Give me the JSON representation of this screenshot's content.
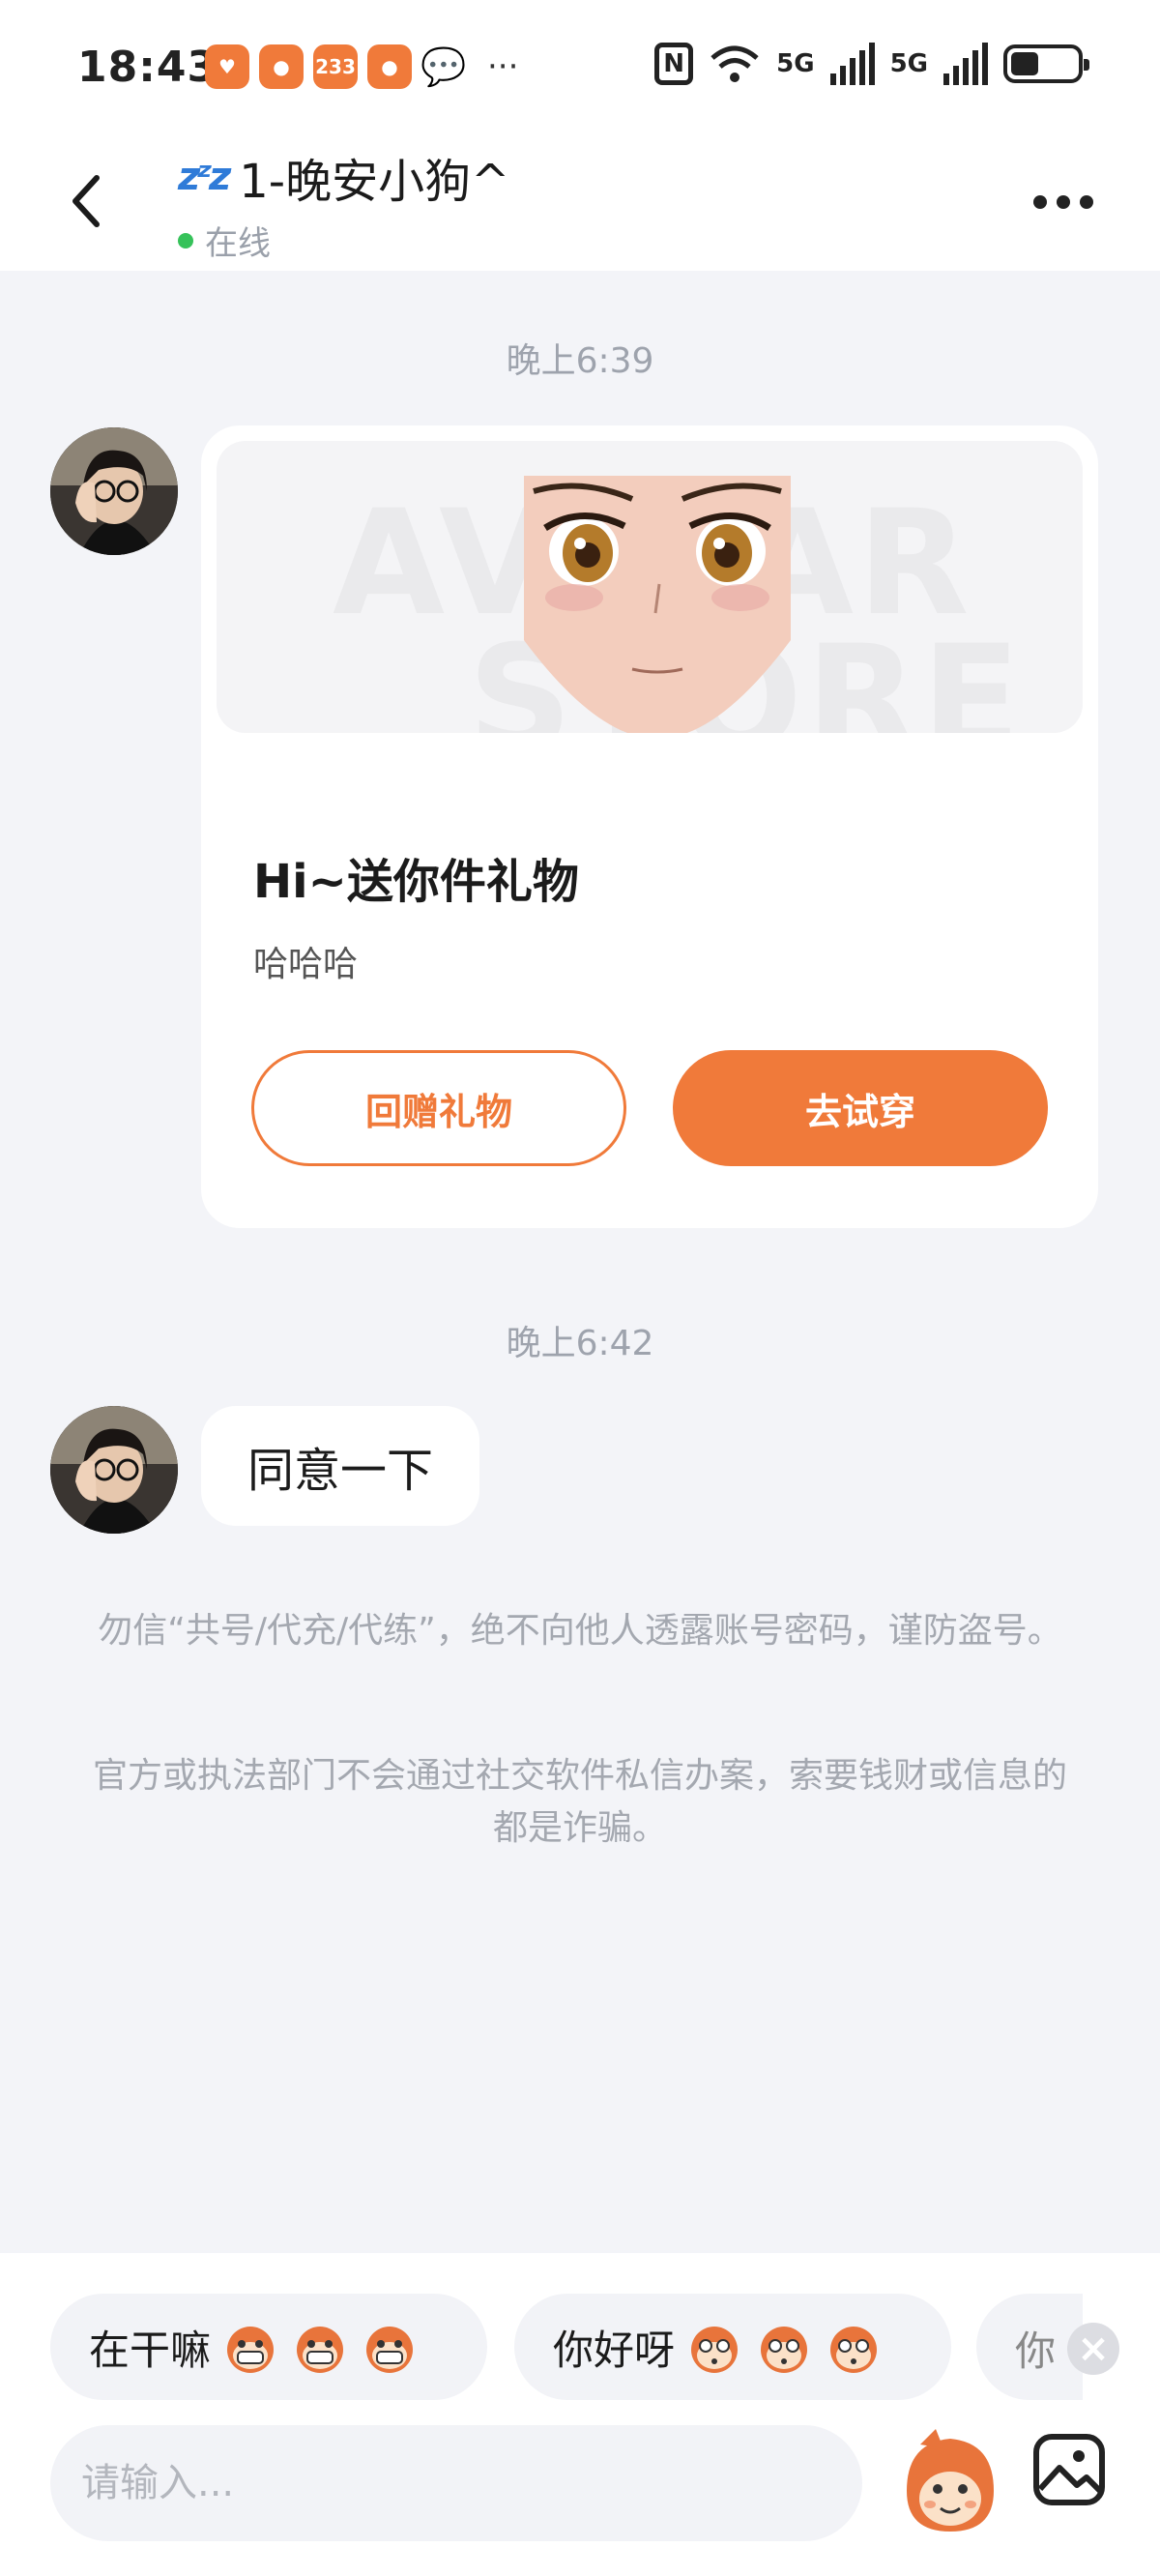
{
  "status_bar": {
    "time": "18:43",
    "app_badges": [
      "heart-app",
      "camera-app",
      "233",
      "camera-app"
    ],
    "app_badge_label_233": "233",
    "overflow": "···",
    "nfc_label": "N",
    "net1": "5G",
    "net2": "5G"
  },
  "header": {
    "sleep_emoji": "zzz",
    "title": "1-晚安小狗^",
    "status": "在线"
  },
  "messages": {
    "ts1": "晚上6:39",
    "gift_card": {
      "watermark": "AVATAR STORE",
      "title": "Hi~送你件礼物",
      "subtitle": "哈哈哈",
      "btn_return": "回赠礼物",
      "btn_try": "去试穿"
    },
    "ts2": "晚上6:42",
    "text_bubble": "同意一下"
  },
  "notices": [
    "勿信“共号/代充/代练”，绝不向他人透露账号密码，谨防盗号。",
    "官方或执法部门不会通过社交软件私信办案，索要钱财或信息的都是诈骗。"
  ],
  "quick_replies": [
    {
      "text": "在干嘛"
    },
    {
      "text": "你好呀"
    },
    {
      "text": "你"
    }
  ],
  "composer": {
    "placeholder": "请输入..."
  },
  "colors": {
    "accent": "#f07a3a",
    "online": "#36c25a",
    "background": "#f3f4f8"
  }
}
